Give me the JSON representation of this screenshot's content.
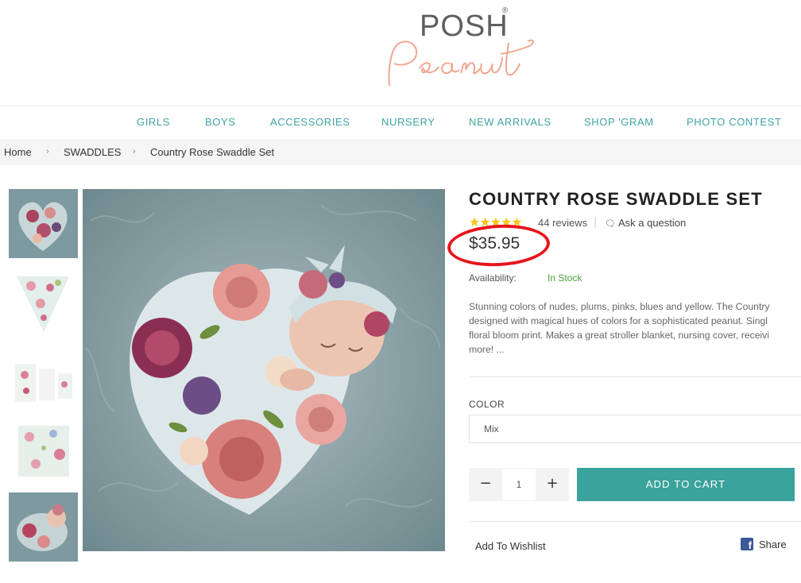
{
  "logo": {
    "top_text": "POSH",
    "script_text": "Peanut",
    "registered": "®"
  },
  "nav": {
    "items": [
      "GIRLS",
      "BOYS",
      "ACCESSORIES",
      "NURSERY",
      "NEW ARRIVALS",
      "SHOP 'GRAM",
      "PHOTO CONTEST"
    ]
  },
  "breadcrumb": {
    "items": [
      "Home",
      "SWADDLES",
      "Country Rose Swaddle Set"
    ],
    "separator": "›"
  },
  "product": {
    "title": "COUNTRY ROSE SWADDLE SET",
    "rating_stars": 5,
    "stars_text": "★★★★★",
    "reviews": "44 reviews",
    "review_separator": "|",
    "ask_question": "Ask a question",
    "price": "$35.95",
    "availability_label": "Availability:",
    "availability_value": "In Stock",
    "description_lines": [
      "Stunning colors of nudes, plums, pinks, blues and yellow. The Country",
      "designed with magical hues of colors for a sophisticated peanut. Singl",
      "floral bloom print. Makes a great stroller blanket, nursing cover, receivi",
      "more! ..."
    ],
    "color_label": "COLOR",
    "color_selected": "Mix",
    "quantity": "1",
    "qty_minus": "−",
    "qty_plus": "+",
    "add_to_cart": "ADD TO CART",
    "wishlist": "Add To Wishlist",
    "share": "Share",
    "fb_glyph": "f"
  },
  "colors": {
    "accent": "#3aa39c",
    "nav_text": "#3fa5a0",
    "in_stock": "#4a9e3f",
    "annotation_circle": "#e8141c",
    "star": "#f5c518"
  },
  "icons": {
    "ask": "speech-bubbles-icon",
    "share": "facebook-icon"
  }
}
